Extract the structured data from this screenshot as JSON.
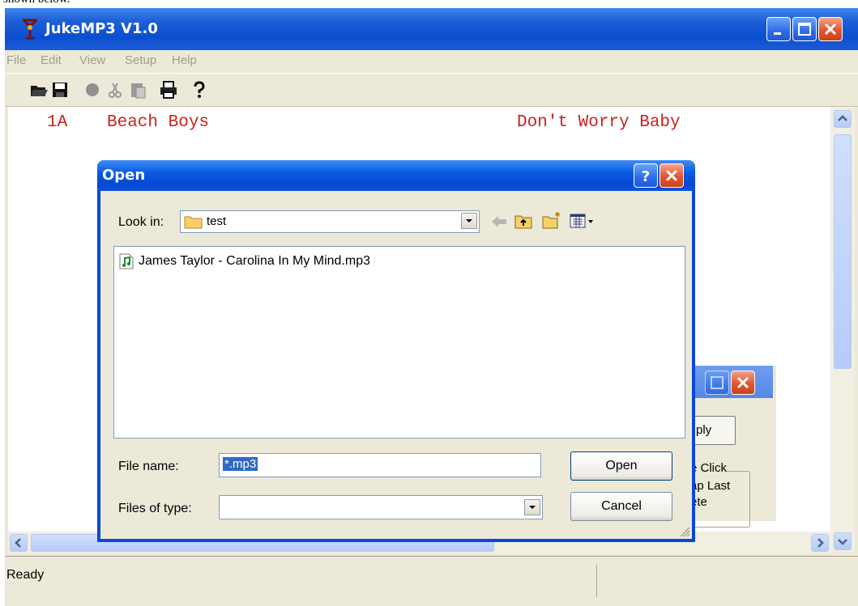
{
  "caption_fragment": "shown below.",
  "app": {
    "title": "JukeMP3 V1.0",
    "menu": [
      "File",
      "Edit",
      "View",
      "Setup",
      "Help"
    ],
    "toolbar_icons": [
      "open-folder-icon",
      "save-disk-icon",
      "record-icon",
      "cut-icon",
      "paste-icon",
      "print-icon",
      "help-icon"
    ],
    "entry": {
      "slot": "1A",
      "artist": "Beach Boys",
      "song": "Don't Worry Baby"
    },
    "status": "Ready"
  },
  "background_dialog": {
    "button_fragment": "ply",
    "group_fragment": "e Click",
    "option1_fragment": "ap Last",
    "option2_fragment": "ete"
  },
  "open_dialog": {
    "title": "Open",
    "look_in_label": "Look in:",
    "look_in_value": "test",
    "files": [
      "James Taylor - Carolina In My Mind.mp3"
    ],
    "file_name_label": "File name:",
    "file_name_value": "*.mp3",
    "files_of_type_label": "Files of type:",
    "files_of_type_value": "",
    "open_label": "Open",
    "cancel_label": "Cancel"
  },
  "colors": {
    "title_blue": "#0a4ed0",
    "song_text": "#c9221c",
    "window_bg": "#ece9d8"
  }
}
